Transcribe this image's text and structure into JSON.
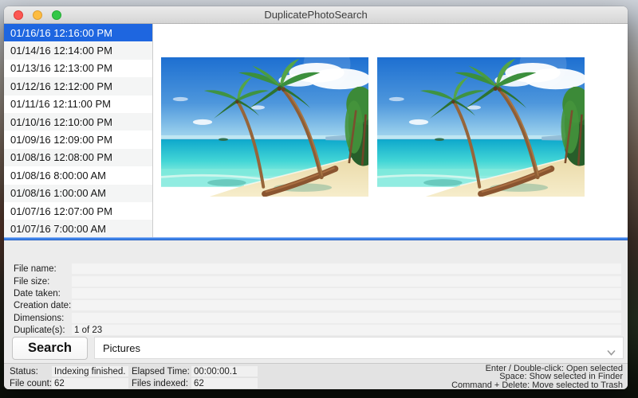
{
  "window": {
    "title": "DuplicatePhotoSearch"
  },
  "titlebar": {
    "traffic_lights": [
      {
        "name": "close",
        "color": "#fc5753"
      },
      {
        "name": "minimize",
        "color": "#fdbc40"
      },
      {
        "name": "zoom",
        "color": "#33c748"
      }
    ]
  },
  "colors": {
    "selection_blue": "#1e66e0",
    "splitter_blue": "#3c82e8",
    "panel_gray": "#ececec"
  },
  "file_list": {
    "selected_index": 0,
    "items": [
      "01/16/16 12:16:00 PM",
      "01/14/16 12:14:00 PM",
      "01/13/16 12:13:00 PM",
      "01/12/16 12:12:00 PM",
      "01/11/16 12:11:00 PM",
      "01/10/16 12:10:00 PM",
      "01/09/16 12:09:00 PM",
      "01/08/16 12:08:00 PM",
      "01/08/16 8:00:00 AM",
      "01/08/16 1:00:00 AM",
      "01/07/16 12:07:00 PM",
      "01/07/16 7:00:00 AM"
    ]
  },
  "photos": {
    "left_alt": "Tropical beach with palm trees (duplicate 1)",
    "right_alt": "Tropical beach with palm trees (duplicate 2)"
  },
  "details": {
    "fields": [
      {
        "label": "File name:",
        "value": ""
      },
      {
        "label": "File size:",
        "value": ""
      },
      {
        "label": "Date taken:",
        "value": ""
      },
      {
        "label": "Creation date:",
        "value": ""
      },
      {
        "label": "Dimensions:",
        "value": ""
      },
      {
        "label": "Duplicate(s):",
        "value": "1 of 23"
      }
    ]
  },
  "search": {
    "button_label": "Search",
    "folder_value": "Pictures"
  },
  "status": {
    "items": [
      {
        "label": "Status:",
        "value": "Indexing finished."
      },
      {
        "label": "Elapsed Time:",
        "value": "00:00:00.1"
      },
      {
        "label": "File count:",
        "value": "62"
      },
      {
        "label": "Files indexed:",
        "value": "62"
      }
    ],
    "shortcuts": [
      "Enter / Double-click: Open selected",
      "Space: Show selected in Finder",
      "Command + Delete: Move selected to Trash"
    ]
  }
}
